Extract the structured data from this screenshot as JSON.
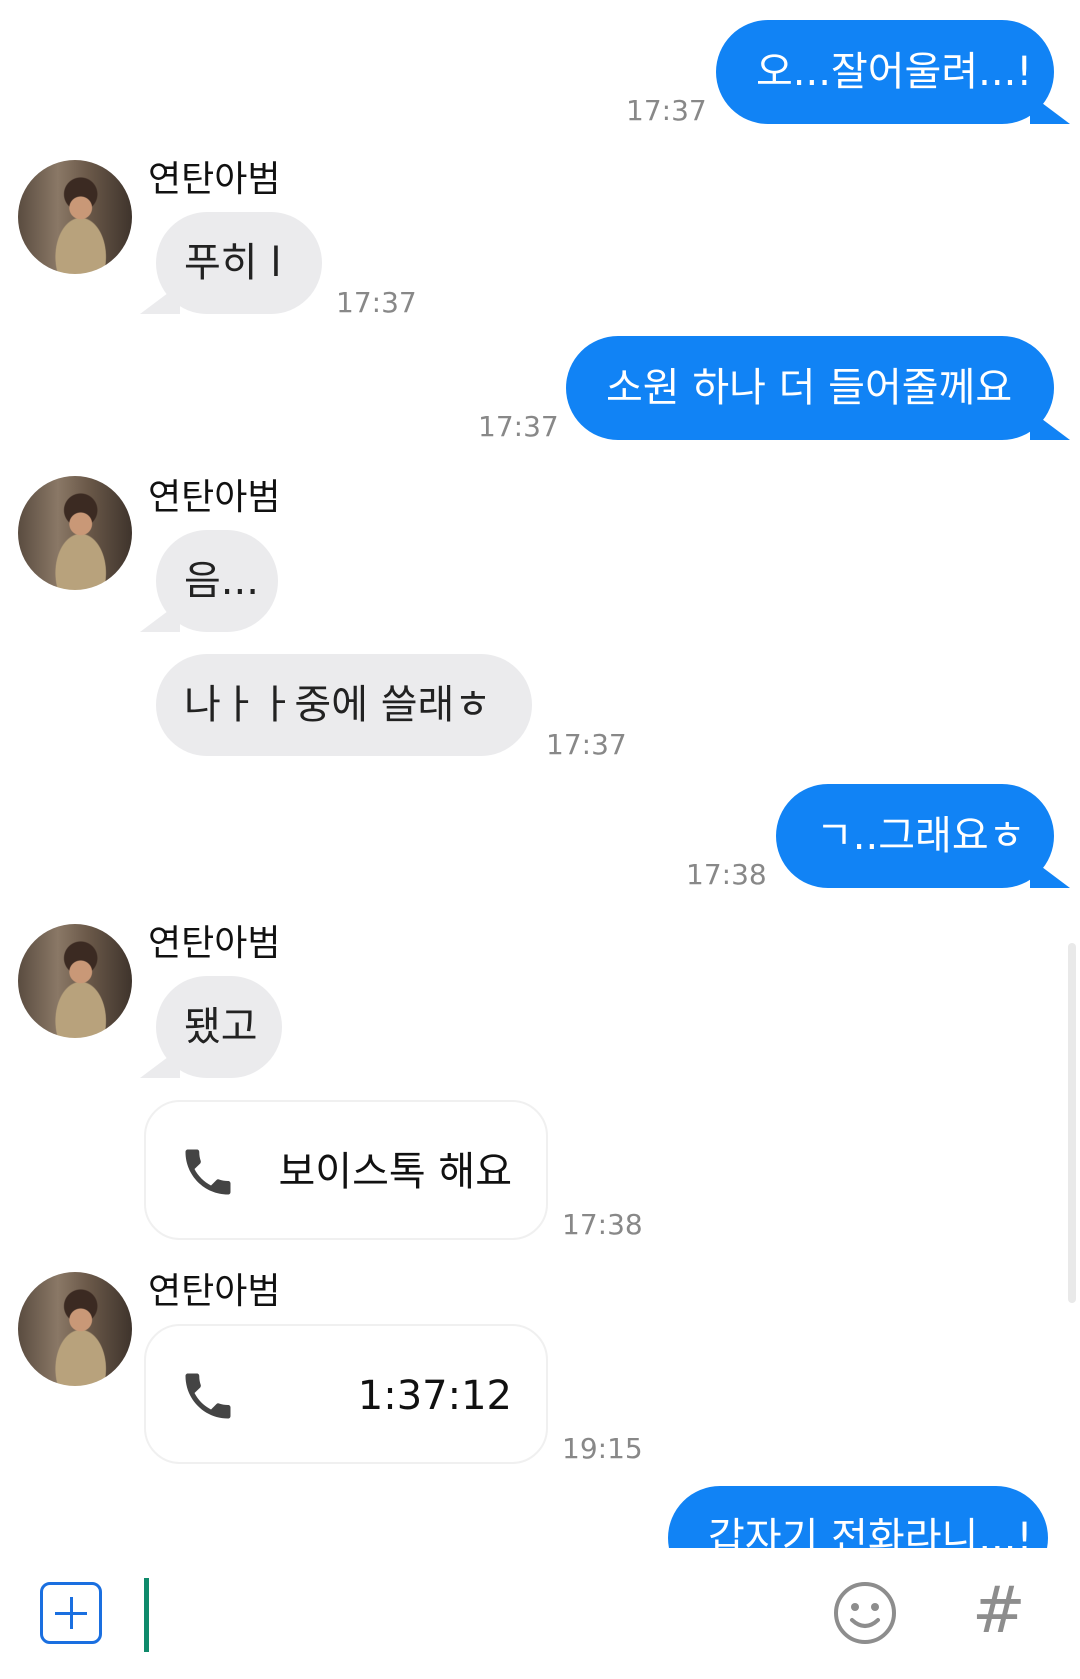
{
  "contact_name": "연탄아범",
  "messages": {
    "m1": {
      "text": "오...잘어울려...!",
      "time": "17:37"
    },
    "m2": {
      "text": "푸히 l",
      "time": "17:37"
    },
    "m3": {
      "text": "소원 하나 더 들어줄께요",
      "time": "17:37"
    },
    "m4a": {
      "text": "음..."
    },
    "m4b": {
      "text": "나ㅏㅏ중에 쓸래ㅎ",
      "time": "17:37"
    },
    "m5": {
      "text": "ㄱ..그래요ㅎ",
      "time": "17:38"
    },
    "m6": {
      "text": "됐고"
    },
    "m7": {
      "text": "보이스톡 해요",
      "time": "17:38"
    },
    "m8": {
      "text": "1:37:12",
      "time": "19:15"
    },
    "m9": {
      "text": "갑자기 전화라니...!"
    }
  },
  "colors": {
    "outgoing_bubble": "#1183f5",
    "incoming_bubble": "#ebebed",
    "accent": "#1a6fe0",
    "cursor": "#0f8a6b"
  },
  "icons": {
    "add": "plus-square-icon",
    "emoji": "smiley-icon",
    "hashtag": "hash-icon",
    "call": "phone-icon"
  },
  "input": {
    "hash_glyph": "#"
  }
}
